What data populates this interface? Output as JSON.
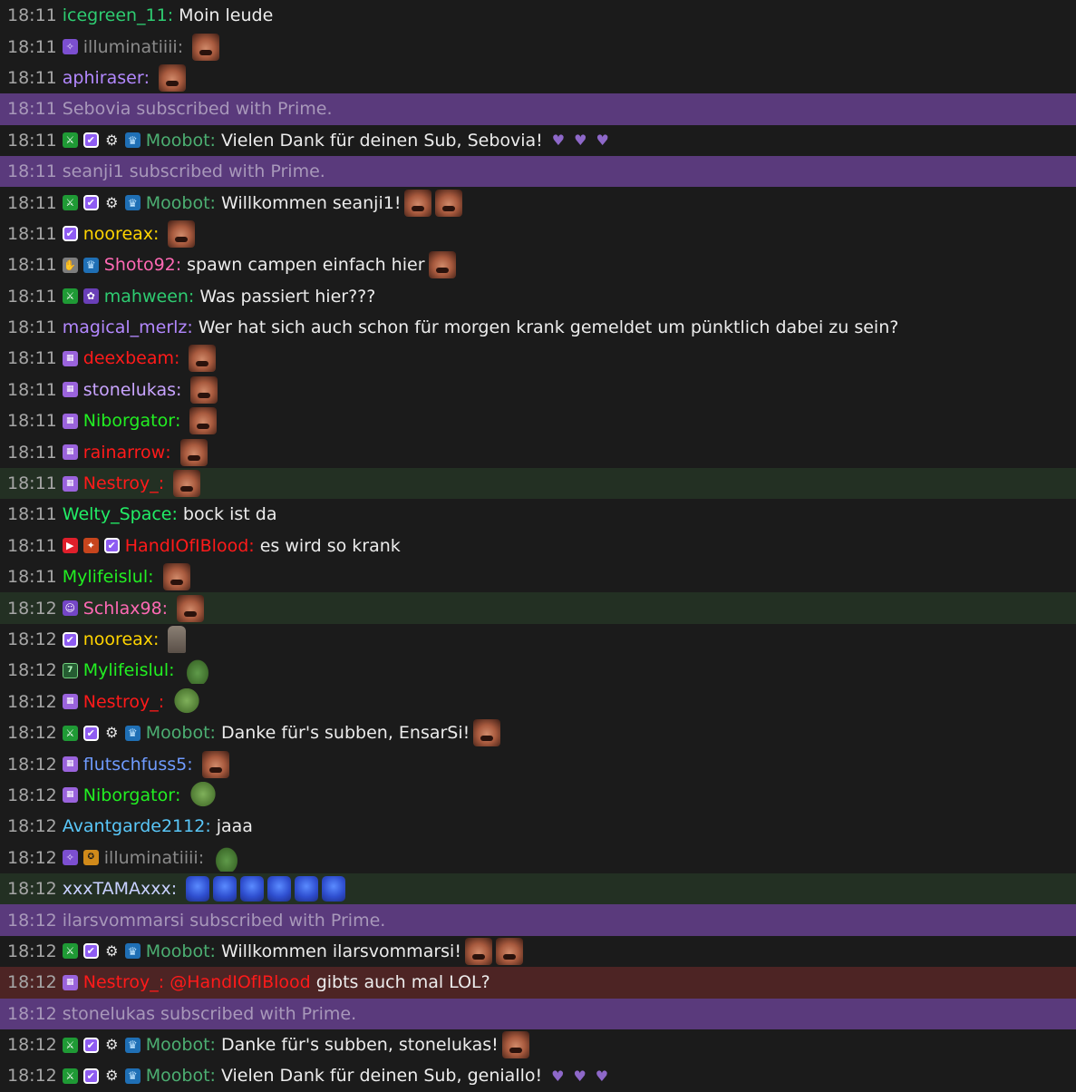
{
  "colors": {
    "notice_bg": "#5a3a7c",
    "highlight_bg": "#233023",
    "mention_bg": "#4d2424",
    "chat_bg": "#1b1b1b"
  },
  "messages": [
    {
      "type": "chat",
      "time": "18:11",
      "badges": [],
      "user": "icegreen_11",
      "color": "#2ecc71",
      "text": "Moin leude",
      "emotes": []
    },
    {
      "type": "chat",
      "time": "18:11",
      "badges": [
        "sub-badge"
      ],
      "user": "illuminatiiii",
      "color": "#8a8a8a",
      "text": "",
      "emotes": [
        "face"
      ]
    },
    {
      "type": "chat",
      "time": "18:11",
      "badges": [],
      "user": "aphiraser",
      "color": "#b388ff",
      "text": "",
      "emotes": [
        "face"
      ]
    },
    {
      "type": "notice",
      "time": "18:11",
      "text": "Sebovia subscribed with Prime."
    },
    {
      "type": "chat",
      "time": "18:11",
      "badges": [
        "mod",
        "verified",
        "gear",
        "crown"
      ],
      "user": "Moobot",
      "color": "#4caf72",
      "text": "Vielen Dank für deinen Sub, Sebovia!",
      "emotes": [],
      "hearts": 3
    },
    {
      "type": "notice",
      "time": "18:11",
      "text": "seanji1 subscribed with Prime."
    },
    {
      "type": "chat",
      "time": "18:11",
      "badges": [
        "mod",
        "verified",
        "gear",
        "crown"
      ],
      "user": "Moobot",
      "color": "#4caf72",
      "text": "Willkommen seanji1!",
      "emotes": [
        "face",
        "face"
      ]
    },
    {
      "type": "chat",
      "time": "18:11",
      "badges": [
        "verified"
      ],
      "user": "nooreax",
      "color": "#ffd400",
      "text": "",
      "emotes": [
        "face"
      ]
    },
    {
      "type": "chat",
      "time": "18:11",
      "badges": [
        "hand",
        "crown"
      ],
      "user": "Shoto92",
      "color": "#ff69b4",
      "text": "spawn campen einfach hier",
      "emotes": [
        "face"
      ]
    },
    {
      "type": "chat",
      "time": "18:11",
      "badges": [
        "mod",
        "tulip"
      ],
      "user": "mahween",
      "color": "#2ecc71",
      "text": "Was passiert hier???",
      "emotes": []
    },
    {
      "type": "chat",
      "time": "18:11",
      "badges": [],
      "user": "magical_merlz",
      "color": "#b388ff",
      "text": "Wer hat sich auch schon für morgen krank gemeldet um pünktlich dabei zu sein?",
      "emotes": []
    },
    {
      "type": "chat",
      "time": "18:11",
      "badges": [
        "tier-badge"
      ],
      "user": "deexbeam",
      "color": "#ff1a1a",
      "text": "",
      "emotes": [
        "face"
      ]
    },
    {
      "type": "chat",
      "time": "18:11",
      "badges": [
        "tier-badge"
      ],
      "user": "stonelukas",
      "color": "#c9a4ff",
      "text": "",
      "emotes": [
        "face"
      ]
    },
    {
      "type": "chat",
      "time": "18:11",
      "badges": [
        "tier-badge"
      ],
      "user": "Niborgator",
      "color": "#22ee22",
      "text": "",
      "emotes": [
        "face"
      ]
    },
    {
      "type": "chat",
      "time": "18:11",
      "badges": [
        "tier-badge"
      ],
      "user": "rainarrow",
      "color": "#ff1a1a",
      "text": "",
      "emotes": [
        "face"
      ]
    },
    {
      "type": "chat",
      "time": "18:11",
      "badges": [
        "tier-badge"
      ],
      "user": "Nestroy_",
      "color": "#ff1a1a",
      "text": "",
      "emotes": [
        "face"
      ],
      "highlight": true
    },
    {
      "type": "chat",
      "time": "18:11",
      "badges": [],
      "user": "Welty_Space",
      "color": "#22ee66",
      "text": "bock ist da",
      "emotes": []
    },
    {
      "type": "chat",
      "time": "18:11",
      "badges": [
        "video",
        "fire",
        "verified"
      ],
      "user": "HandIOfIBlood",
      "color": "#ff1a1a",
      "text": "es wird so krank",
      "emotes": []
    },
    {
      "type": "chat",
      "time": "18:11",
      "badges": [],
      "user": "Mylifeislul",
      "color": "#22ee22",
      "text": "",
      "emotes": [
        "face"
      ]
    },
    {
      "type": "chat",
      "time": "18:12",
      "badges": [
        "cake"
      ],
      "user": "Schlax98",
      "color": "#ff69b4",
      "text": "",
      "emotes": [
        "face"
      ],
      "highlight": true
    },
    {
      "type": "chat",
      "time": "18:12",
      "badges": [
        "verified"
      ],
      "user": "nooreax",
      "color": "#ffd400",
      "text": "",
      "emotes": [
        "cat"
      ]
    },
    {
      "type": "chat",
      "time": "18:12",
      "badges": [
        "seven"
      ],
      "user": "Mylifeislul",
      "color": "#22ee22",
      "text": "",
      "emotes": [
        "peepo"
      ]
    },
    {
      "type": "chat",
      "time": "18:12",
      "badges": [
        "tier-badge"
      ],
      "user": "Nestroy_",
      "color": "#ff1a1a",
      "text": "",
      "emotes": [
        "frog"
      ]
    },
    {
      "type": "chat",
      "time": "18:12",
      "badges": [
        "mod",
        "verified",
        "gear",
        "crown"
      ],
      "user": "Moobot",
      "color": "#4caf72",
      "text": "Danke für's subben, EnsarSi!",
      "emotes": [
        "face"
      ]
    },
    {
      "type": "chat",
      "time": "18:12",
      "badges": [
        "tier-badge"
      ],
      "user": "flutschfuss5",
      "color": "#6f9bff",
      "text": "",
      "emotes": [
        "face"
      ]
    },
    {
      "type": "chat",
      "time": "18:12",
      "badges": [
        "tier-badge"
      ],
      "user": "Niborgator",
      "color": "#22ee22",
      "text": "",
      "emotes": [
        "frog"
      ]
    },
    {
      "type": "chat",
      "time": "18:12",
      "badges": [],
      "user": "Avantgarde2112",
      "color": "#5ac8fa",
      "text": "jaaa",
      "emotes": []
    },
    {
      "type": "chat",
      "time": "18:12",
      "badges": [
        "sub-badge",
        "gold"
      ],
      "user": "illuminatiiii",
      "color": "#8a8a8a",
      "text": "",
      "emotes": [
        "peepo"
      ]
    },
    {
      "type": "chat",
      "time": "18:12",
      "badges": [],
      "user": "xxxTAMAxxx",
      "color": "#c8d0ff",
      "text": "",
      "emotes": [
        "blue",
        "blue",
        "blue",
        "blue",
        "blue",
        "blue"
      ],
      "highlight": true
    },
    {
      "type": "notice",
      "time": "18:12",
      "text": "ilarsvommarsi subscribed with Prime."
    },
    {
      "type": "chat",
      "time": "18:12",
      "badges": [
        "mod",
        "verified",
        "gear",
        "crown"
      ],
      "user": "Moobot",
      "color": "#4caf72",
      "text": "Willkommen ilarsvommarsi!",
      "emotes": [
        "face",
        "face"
      ]
    },
    {
      "type": "chat",
      "time": "18:12",
      "badges": [
        "tier-badge"
      ],
      "user": "Nestroy_",
      "color": "#ff1a1a",
      "mention": "@HandIOfIBlood",
      "text": "gibts auch mal LOL?",
      "emotes": [],
      "mentionRow": true
    },
    {
      "type": "notice",
      "time": "18:12",
      "text": "stonelukas subscribed with Prime."
    },
    {
      "type": "chat",
      "time": "18:12",
      "badges": [
        "mod",
        "verified",
        "gear",
        "crown"
      ],
      "user": "Moobot",
      "color": "#4caf72",
      "text": "Danke für's subben, stonelukas!",
      "emotes": [
        "face"
      ]
    },
    {
      "type": "chat",
      "time": "18:12",
      "badges": [
        "mod",
        "verified",
        "gear",
        "crown"
      ],
      "user": "Moobot",
      "color": "#4caf72",
      "text": "Vielen Dank für deinen Sub, geniallo!",
      "emotes": [],
      "hearts": 3
    }
  ]
}
